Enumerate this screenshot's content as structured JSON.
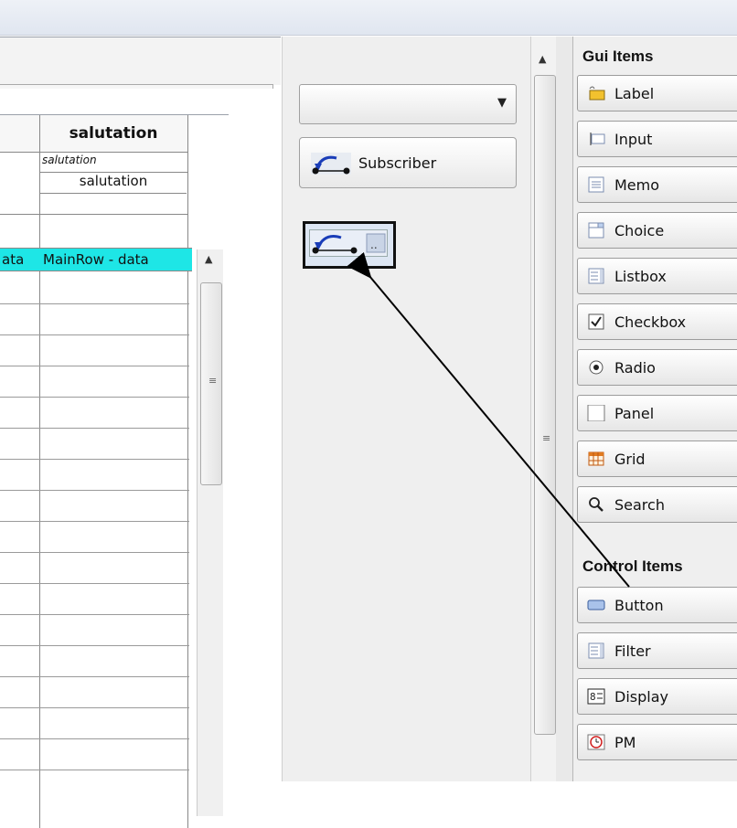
{
  "grid": {
    "column_title": "salutation",
    "subheader_italic": "salutation",
    "subheader_value": "salutation",
    "highlight_left": "ata",
    "highlight_right": "MainRow - data"
  },
  "middle": {
    "combo_value": "",
    "subscriber_label": "Subscriber"
  },
  "palette": {
    "gui_title": "Gui Items",
    "gui_items": [
      {
        "label": "Label",
        "icon": "label-icon"
      },
      {
        "label": "Input",
        "icon": "input-icon"
      },
      {
        "label": "Memo",
        "icon": "memo-icon"
      },
      {
        "label": "Choice",
        "icon": "choice-icon"
      },
      {
        "label": "Listbox",
        "icon": "listbox-icon"
      },
      {
        "label": "Checkbox",
        "icon": "checkbox-icon"
      },
      {
        "label": "Radio",
        "icon": "radio-icon"
      },
      {
        "label": "Panel",
        "icon": "panel-icon"
      },
      {
        "label": "Grid",
        "icon": "grid-icon"
      },
      {
        "label": "Search",
        "icon": "search-icon"
      }
    ],
    "control_title": "Control Items",
    "control_items": [
      {
        "label": "Button",
        "icon": "button-icon"
      },
      {
        "label": "Filter",
        "icon": "filter-icon"
      },
      {
        "label": "Display",
        "icon": "display-icon"
      },
      {
        "label": "PM",
        "icon": "clock-icon"
      }
    ]
  }
}
